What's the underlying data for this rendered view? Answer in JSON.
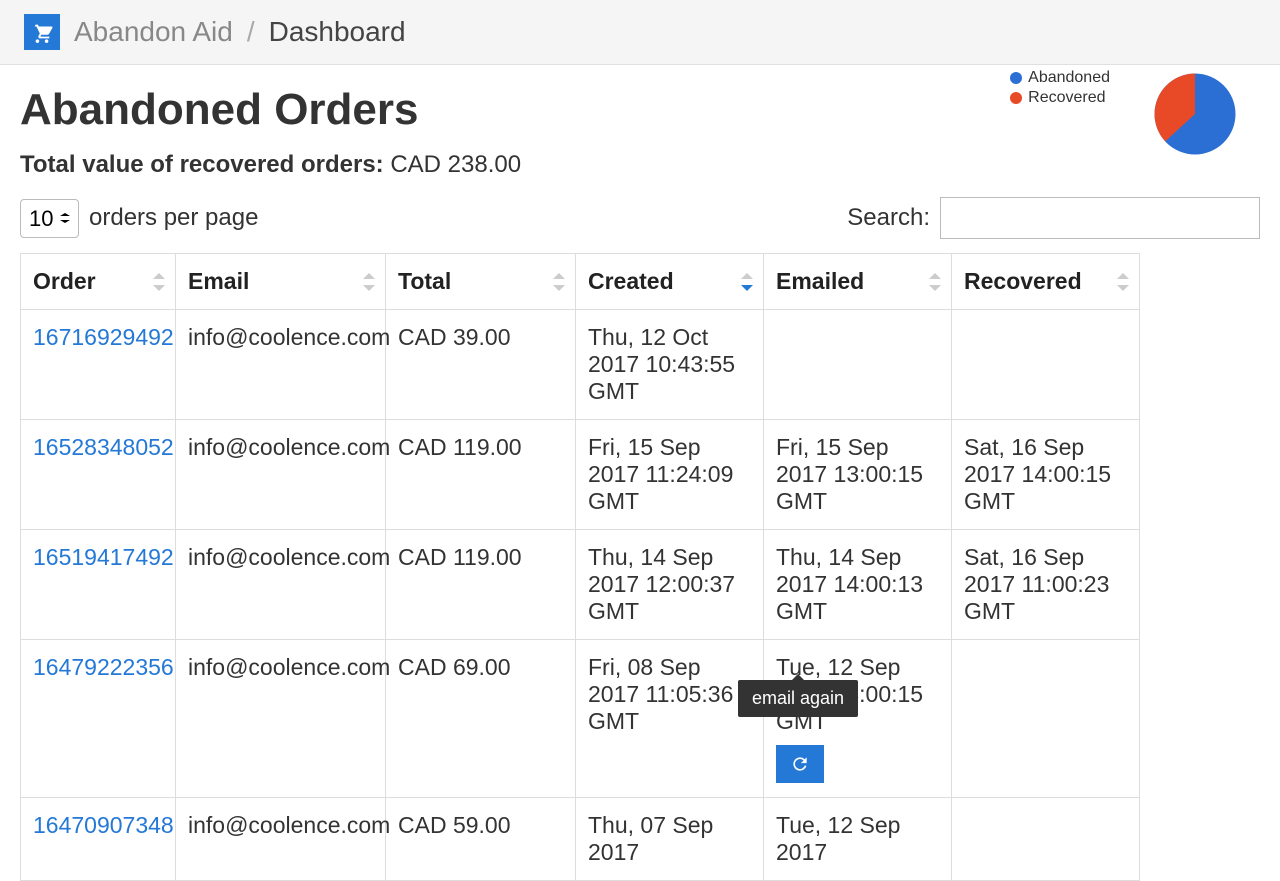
{
  "header": {
    "app_name": "Abandon Aid",
    "crumb_current": "Dashboard"
  },
  "page": {
    "title": "Abandoned Orders",
    "total_label": "Total value of recovered orders:",
    "total_value": "CAD 238.00",
    "per_page_value": "10",
    "per_page_suffix": "orders per page",
    "search_label": "Search:"
  },
  "legend": {
    "abandoned": {
      "label": "Abandoned",
      "color": "#2c6fd4"
    },
    "recovered": {
      "label": "Recovered",
      "color": "#e84a27"
    }
  },
  "chart_data": {
    "type": "pie",
    "title": "",
    "series": [
      {
        "name": "Abandoned",
        "value": 60
      },
      {
        "name": "Recovered",
        "value": 40
      }
    ]
  },
  "columns": {
    "order": "Order",
    "email": "Email",
    "total": "Total",
    "created": "Created",
    "emailed": "Emailed",
    "recovered": "Recovered"
  },
  "rows": [
    {
      "order": "16716929492",
      "email": "info@coolence.com",
      "total": "CAD 39.00",
      "created": "Thu, 12 Oct 2017 10:43:55 GMT",
      "emailed": "",
      "recovered": ""
    },
    {
      "order": "16528348052",
      "email": "info@coolence.com",
      "total": "CAD 119.00",
      "created": "Fri, 15 Sep 2017 11:24:09 GMT",
      "emailed": "Fri, 15 Sep 2017 13:00:15 GMT",
      "recovered": "Sat, 16 Sep 2017 14:00:15 GMT"
    },
    {
      "order": "16519417492",
      "email": "info@coolence.com",
      "total": "CAD 119.00",
      "created": "Thu, 14 Sep 2017 12:00:37 GMT",
      "emailed": "Thu, 14 Sep 2017 14:00:13 GMT",
      "recovered": "Sat, 16 Sep 2017 11:00:23 GMT"
    },
    {
      "order": "16479222356",
      "email": "info@coolence.com",
      "total": "CAD 69.00",
      "created": "Fri, 08 Sep 2017 11:05:36 GMT",
      "emailed": "Tue, 12 Sep 2017 03:00:15 GMT",
      "recovered": "",
      "resend": true
    },
    {
      "order": "16470907348",
      "email": "info@coolence.com",
      "total": "CAD 59.00",
      "created": "Thu, 07 Sep 2017",
      "emailed": "Tue, 12 Sep 2017",
      "recovered": ""
    }
  ],
  "tooltip": {
    "email_again": "email again"
  }
}
